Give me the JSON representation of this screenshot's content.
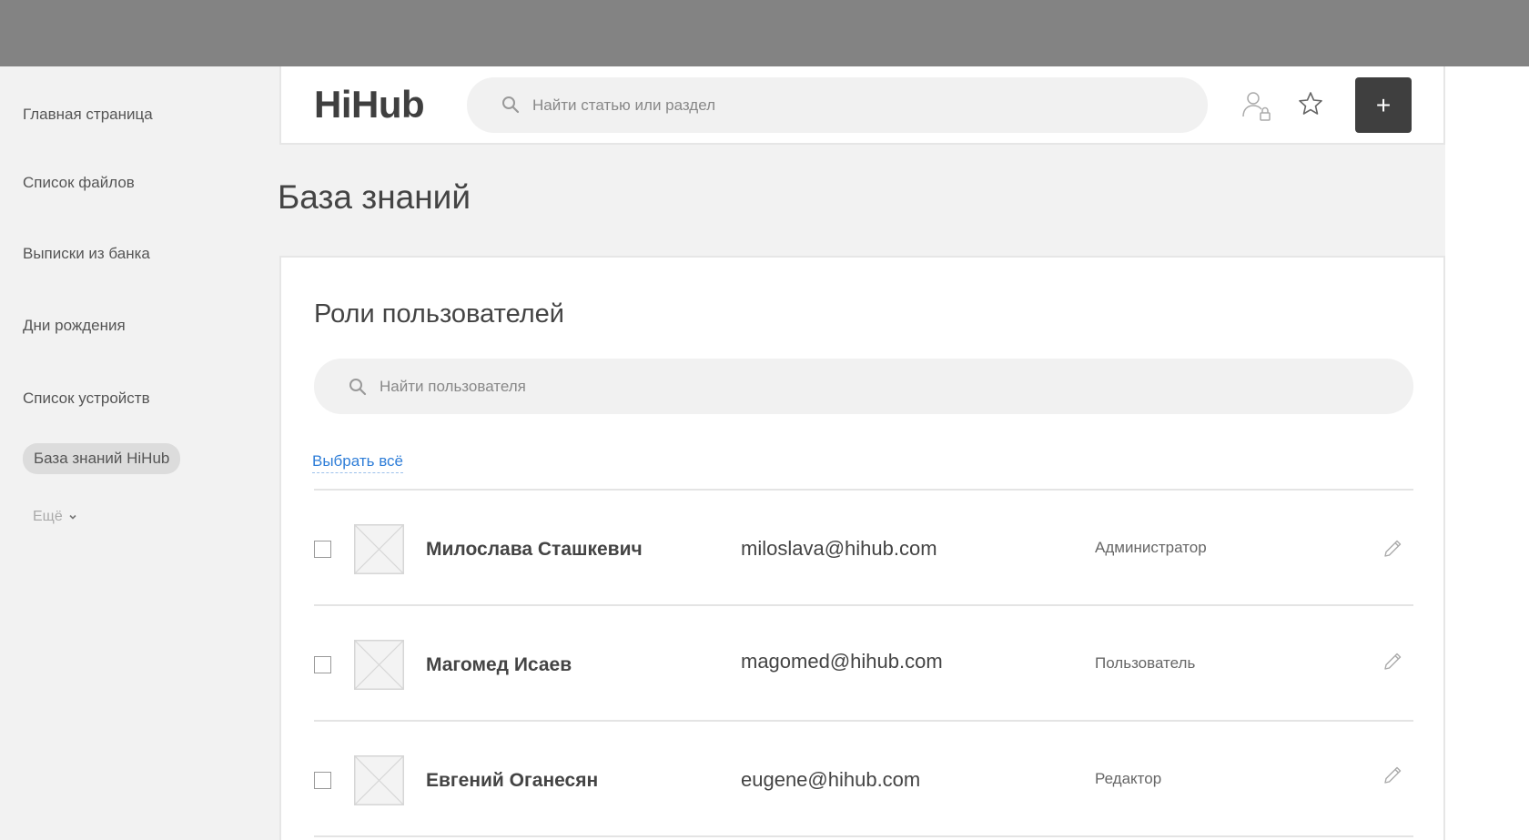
{
  "app": {
    "logo": "HiHub"
  },
  "header": {
    "search_placeholder": "Найти статью или раздел",
    "add_label": "+"
  },
  "sidebar": {
    "items": [
      {
        "label": "Главная страница"
      },
      {
        "label": "Список файлов"
      },
      {
        "label": "Выписки из банка"
      },
      {
        "label": "Дни рождения"
      },
      {
        "label": "Список устройств"
      },
      {
        "label": "База знаний HiHub",
        "active": true
      }
    ],
    "more_label": "Ещё"
  },
  "page": {
    "title": "База знаний"
  },
  "roles": {
    "title": "Роли пользователей",
    "search_placeholder": "Найти пользователя",
    "select_all": "Выбрать всё",
    "users": [
      {
        "name": "Милослава Сташкевич",
        "email": "miloslava@hihub.com",
        "role": "Администратор"
      },
      {
        "name": "Магомед Исаев",
        "email": "magomed@hihub.com",
        "role": "Пользователь"
      },
      {
        "name": "Евгений Оганесян",
        "email": "eugene@hihub.com",
        "role": "Редактор"
      }
    ]
  },
  "colors": {
    "topbar": "#838383",
    "accent_link": "#2f7ed8",
    "primary_button": "#3f3f3f",
    "background": "#f2f2f2"
  },
  "icons": [
    "search-icon",
    "user-lock-icon",
    "star-icon",
    "plus-icon",
    "chevron-down-icon",
    "avatar-placeholder-icon",
    "pencil-icon"
  ]
}
